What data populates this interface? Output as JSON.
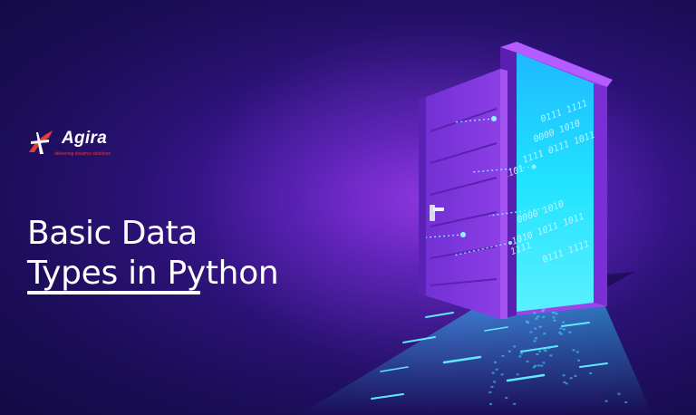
{
  "logo": {
    "name": "Agira",
    "tagline": "delivering dreamst solutions"
  },
  "title": {
    "line1": "Basic Data",
    "line2": "Types in Python"
  },
  "binary_strings": [
    "0111 1111",
    "0000 1010",
    "1111 0111 1011",
    "0100 1101",
    "0000 1010",
    "1010 1011 1011",
    "0100 1100 1111",
    "0111 1111"
  ],
  "colors": {
    "background": "#1a0d55",
    "door": "#8a3be0",
    "door_frame": "#a24ef0",
    "light": "#25e6ff",
    "logo_red": "#e33a3a",
    "text": "#ffffff"
  }
}
